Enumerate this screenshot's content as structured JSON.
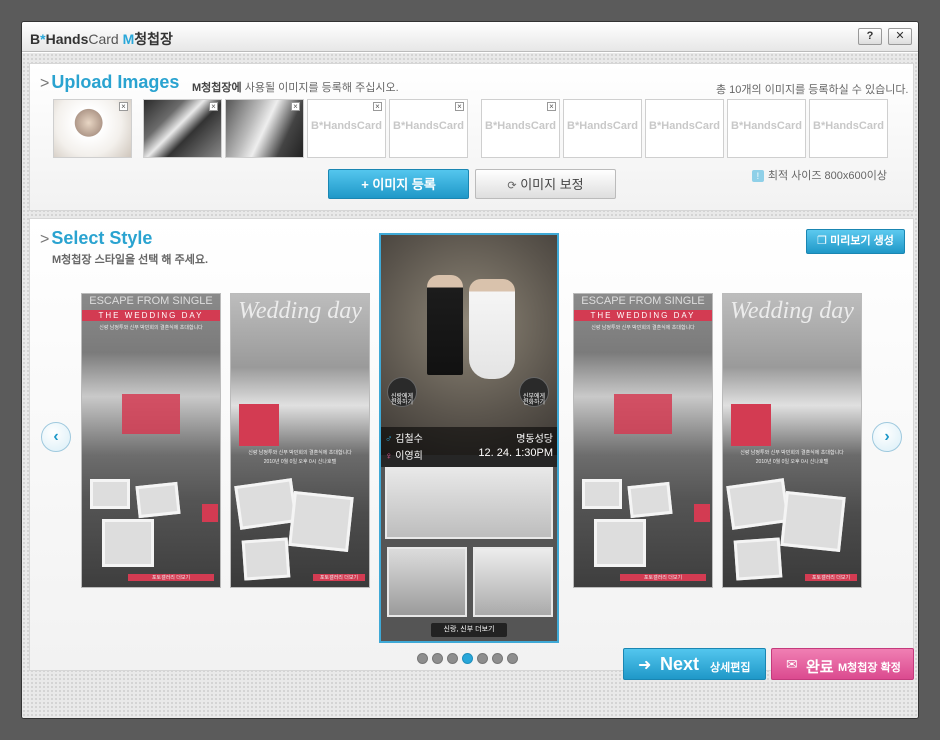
{
  "titlebar": {
    "logo_b": "B",
    "logo_star": "*",
    "logo_hands": "Hands",
    "logo_card": "Card",
    "logo_m": "M",
    "logo_product": "청첩장",
    "help_label": "?",
    "close_label": "✕"
  },
  "upload": {
    "title": "Upload Images",
    "subtitle_bold": "M청첩장에",
    "subtitle": "사용될 이미지를 등록해 주십시오.",
    "count_note": "총 10개의 이미지를 등록하실 수 있습니다.",
    "placeholder_label": "B*HandsCard",
    "register_button": "+ 이미지 등록",
    "adjust_button": "이미지 보정",
    "size_badge": "!",
    "size_info": "최적 사이즈 800x600이상"
  },
  "style": {
    "title": "Select Style",
    "subtitle": "M청첩장 스타일을 선택 해 주세요.",
    "preview_button": "미리보기 생성",
    "card_a_title": "ESCAPE FROM SINGLE",
    "card_a_ribbon": "THE WEDDING DAY",
    "card_b_title": "Wedding day",
    "card_call_groom": "신랑에게 전화하기",
    "card_call_bride": "신부에게 전화하기",
    "card_footer": "포토갤러리 더보기",
    "card_invite": "신랑 남정투와 신부 박민희의 결혼식에 초대합니다",
    "card_date": "2010년 0월 0일 오후 0시 신나호텔",
    "center": {
      "groom_call": "신랑에게 전화하기",
      "bride_call": "신부에게 전화하기",
      "groom_name": "김철수",
      "bride_name": "이영희",
      "venue": "명동성당",
      "datetime": "12. 24. 1:30PM",
      "more": "신랑, 신부 더보기"
    },
    "total_pages": 7,
    "current_page": 4
  },
  "footer": {
    "next_label": "Next",
    "next_sub": "상세편집",
    "done_label": "완료",
    "done_sub_m": "M",
    "done_sub": "청첩장 확정"
  },
  "colors": {
    "accent_blue": "#29a7d9",
    "accent_pink": "#db4a8f",
    "brand_red": "#d33b52"
  }
}
